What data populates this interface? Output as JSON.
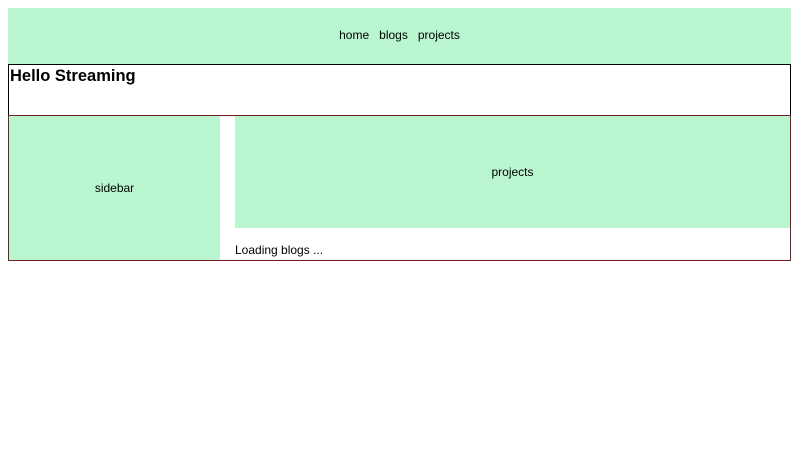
{
  "nav": {
    "items": [
      {
        "label": "home"
      },
      {
        "label": "blogs"
      },
      {
        "label": "projects"
      }
    ]
  },
  "header": {
    "title": "Hello Streaming"
  },
  "content": {
    "sidebar_label": "sidebar",
    "projects_label": "projects",
    "loading_text": "Loading blogs ..."
  },
  "colors": {
    "panel_green": "#b9f6cf",
    "content_border": "#7a1f1f"
  }
}
